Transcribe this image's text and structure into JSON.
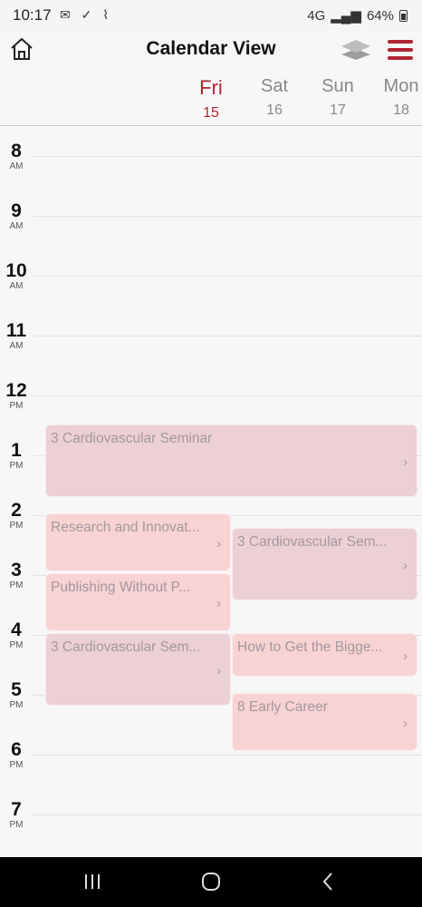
{
  "status": {
    "time": "10:17",
    "notif_icons": "✉ ✓ ⌇",
    "network": "4G",
    "battery": "64%"
  },
  "header": {
    "title": "Calendar View"
  },
  "days": [
    {
      "name": "Fri",
      "num": "15",
      "active": true
    },
    {
      "name": "Sat",
      "num": "16"
    },
    {
      "name": "Sun",
      "num": "17"
    },
    {
      "name": "Mon",
      "num": "18"
    }
  ],
  "hours": [
    {
      "h": "8",
      "ap": "AM"
    },
    {
      "h": "9",
      "ap": "AM"
    },
    {
      "h": "10",
      "ap": "AM"
    },
    {
      "h": "11",
      "ap": "AM"
    },
    {
      "h": "12",
      "ap": "PM"
    },
    {
      "h": "1",
      "ap": "PM"
    },
    {
      "h": "2",
      "ap": "PM"
    },
    {
      "h": "3",
      "ap": "PM"
    },
    {
      "h": "4",
      "ap": "PM"
    },
    {
      "h": "5",
      "ap": "PM"
    },
    {
      "h": "6",
      "ap": "PM"
    },
    {
      "h": "7",
      "ap": "PM"
    }
  ],
  "events": [
    {
      "title": "3 Cardiovascular Seminar",
      "chevron": "›"
    },
    {
      "title": "Research and Innovat...",
      "chevron": "›"
    },
    {
      "title": "3 Cardiovascular Sem...",
      "chevron": "›"
    },
    {
      "title": "Publishing Without P...",
      "chevron": "›"
    },
    {
      "title": "3 Cardiovascular Sem...",
      "chevron": "›"
    },
    {
      "title": "How to Get the Bigge...",
      "chevron": "›"
    },
    {
      "title": "8 Early Career",
      "chevron": "›"
    }
  ],
  "colors": {
    "accent": "#b0252f",
    "event_pink": "#f8d3d4",
    "event_mauve": "#ecd0d5"
  }
}
